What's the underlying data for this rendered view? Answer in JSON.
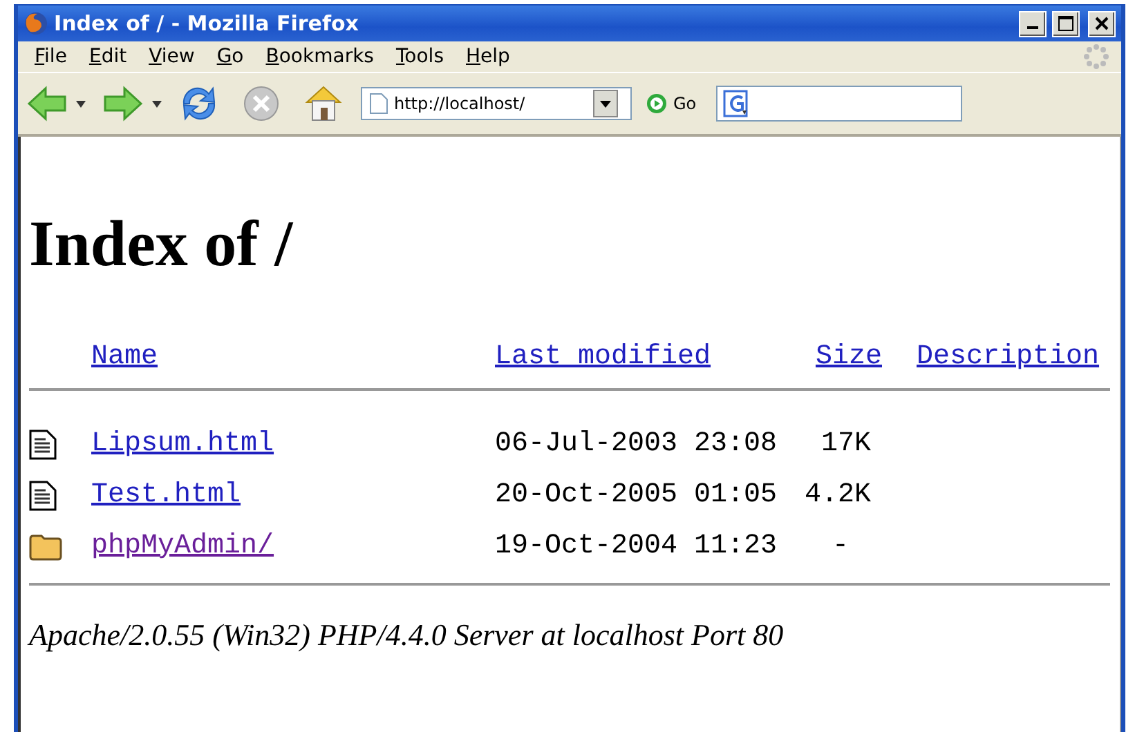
{
  "window": {
    "title": "Index of / - Mozilla Firefox"
  },
  "menu": [
    {
      "accel": "F",
      "rest": "ile"
    },
    {
      "accel": "E",
      "rest": "dit"
    },
    {
      "accel": "V",
      "rest": "iew"
    },
    {
      "accel": "G",
      "rest": "o"
    },
    {
      "accel": "B",
      "rest": "ookmarks"
    },
    {
      "accel": "T",
      "rest": "ools"
    },
    {
      "accel": "H",
      "rest": "elp"
    }
  ],
  "toolbar": {
    "address": "http://localhost/",
    "go": "Go"
  },
  "page": {
    "heading": "Index of /",
    "columns": [
      "Name",
      "Last modified",
      "Size",
      "Description"
    ],
    "rows": [
      {
        "kind": "file",
        "name": "Lipsum.html",
        "modified": "06-Jul-2003 23:08",
        "size": "17K",
        "visited": false
      },
      {
        "kind": "file",
        "name": "Test.html",
        "modified": "20-Oct-2005 01:05",
        "size": "4.2K",
        "visited": false
      },
      {
        "kind": "folder",
        "name": "phpMyAdmin/",
        "modified": "19-Oct-2004 11:23",
        "size": "-",
        "visited": true
      }
    ],
    "address": "Apache/2.0.55 (Win32) PHP/4.4.0 Server at localhost Port 80"
  }
}
